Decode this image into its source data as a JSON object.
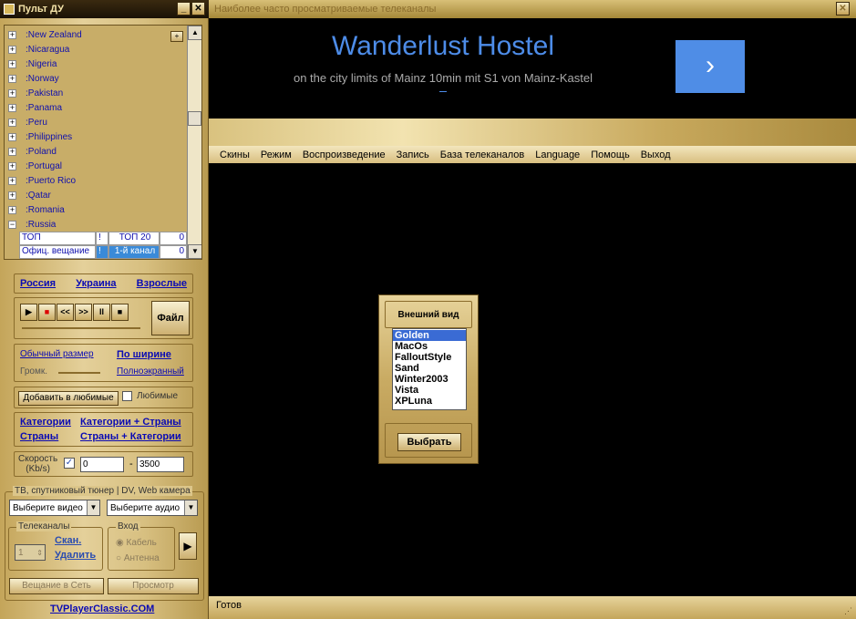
{
  "left": {
    "title": "Пульт ДУ",
    "tree": [
      "New Zealand",
      "Nicaragua",
      "Nigeria",
      "Norway",
      "Pakistan",
      "Panama",
      "Peru",
      "Philippines",
      "Poland",
      "Portugal",
      "Puerto Rico",
      "Qatar",
      "Romania",
      "Russia"
    ],
    "grid": [
      [
        "ТОП",
        "!",
        "ТОП 20",
        "0"
      ],
      [
        "Офиц. вещание",
        "!",
        "1-й канал",
        "0"
      ]
    ],
    "quick_links": [
      "Россия",
      "Украина",
      "Взрослые"
    ],
    "player_buttons": [
      "▶",
      "■",
      "<<",
      ">>",
      "II",
      "■"
    ],
    "file_button": "Файл",
    "size_normal": "Обычный размер",
    "size_width": "По ширине",
    "volume_label": "Громк.",
    "fullscreen": "Полноэкранный",
    "add_fav": "Добавить в любимые",
    "fav_label": "Любимые",
    "cat_links": [
      "Категории",
      "Категории + Страны",
      "Страны",
      "Страны + Категории"
    ],
    "speed_label": "Скорость",
    "speed_unit": "(Kb/s)",
    "speed_from": "0",
    "speed_dash": "-",
    "speed_to": "3500",
    "tuner_label": "ТВ, спутниковый тюнер | DV, Web камера",
    "video_select": "Выберите видео",
    "audio_select": "Выберите аудио",
    "channels_label": "Телеканалы",
    "channel_num": "1",
    "scan": "Скан.",
    "delete": "Удалить",
    "input_label": "Вход",
    "cable": "Кабель",
    "antenna": "Антенна",
    "broadcast": "Вещание в Сеть",
    "preview": "Просмотр",
    "site": "TVPlayerClassic.COM"
  },
  "ad": {
    "bar_title": "Наиболее часто просматриваемые телеканалы",
    "title": "Wanderlust Hostel",
    "subtitle": "on the city limits of Mainz 10min mit S1 von Mainz-Kastel",
    "arrow": "›"
  },
  "menu": [
    "Скины",
    "Режим",
    "Воспроизведение",
    "Запись",
    "База телеканалов",
    "Language",
    "Помощь",
    "Выход"
  ],
  "skin": {
    "title": "Внешний вид",
    "items": [
      "Golden",
      "MacOs",
      "FalloutStyle",
      "Sand",
      "Winter2003",
      "Vista",
      "XPLuna"
    ],
    "button": "Выбрать"
  },
  "status": "Готов"
}
